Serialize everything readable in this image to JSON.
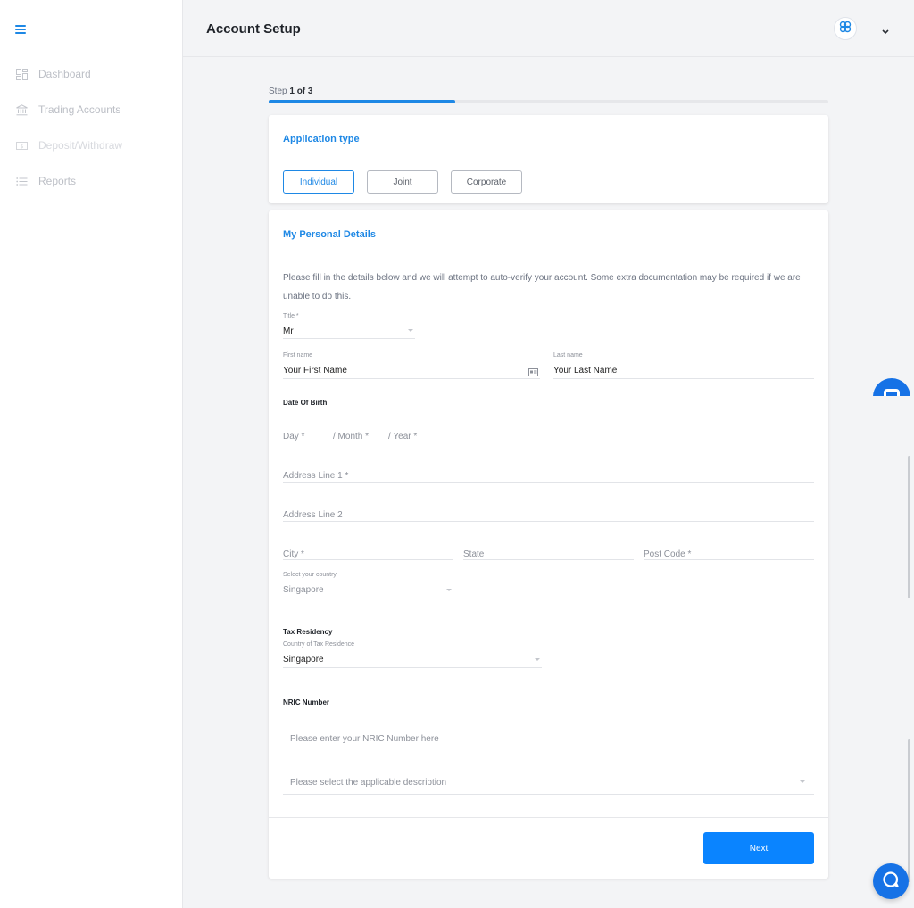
{
  "app": {
    "accent_color": "#1e88e5",
    "button_color": "#0a84ff"
  },
  "sidebar": {
    "items": [
      {
        "label": "Dashboard",
        "icon": "dashboard-icon"
      },
      {
        "label": "Trading Accounts",
        "icon": "bank-icon"
      },
      {
        "label": "Deposit/Withdraw",
        "icon": "money-icon"
      },
      {
        "label": "Reports",
        "icon": "list-icon"
      }
    ]
  },
  "header": {
    "title": "Account Setup"
  },
  "step": {
    "prefix": "Step ",
    "current": "1 of 3",
    "progress": 0.333
  },
  "application_type": {
    "title": "Application type",
    "options": [
      "Individual",
      "Joint",
      "Corporate"
    ],
    "selected": "Individual"
  },
  "personal": {
    "title": "My Personal Details",
    "intro": "Please fill in the details below and we will attempt to auto-verify your account. Some extra documentation may be required if we are unable to do this.",
    "title_field": {
      "label": "Title *",
      "value": "Mr"
    },
    "first_name": {
      "label": "First name",
      "value": "Your First Name"
    },
    "last_name": {
      "label": "Last name",
      "value": "Your Last Name"
    },
    "dob": {
      "heading": "Date Of Birth",
      "day": "Day *",
      "month": "/ Month *",
      "year": "/ Year *"
    },
    "address1": "Address Line 1 *",
    "address2": "Address Line 2",
    "city": "City *",
    "state": "State",
    "postcode": "Post Code *",
    "country": {
      "label": "Select your country",
      "value": "Singapore"
    },
    "tax": {
      "heading": "Tax Residency",
      "label": "Country of Tax Residence",
      "value": "Singapore"
    },
    "nric": {
      "heading": "NRIC Number",
      "placeholder": "Please enter your NRIC Number here",
      "description_placeholder": "Please select the applicable description"
    }
  },
  "footer": {
    "next_label": "Next"
  }
}
